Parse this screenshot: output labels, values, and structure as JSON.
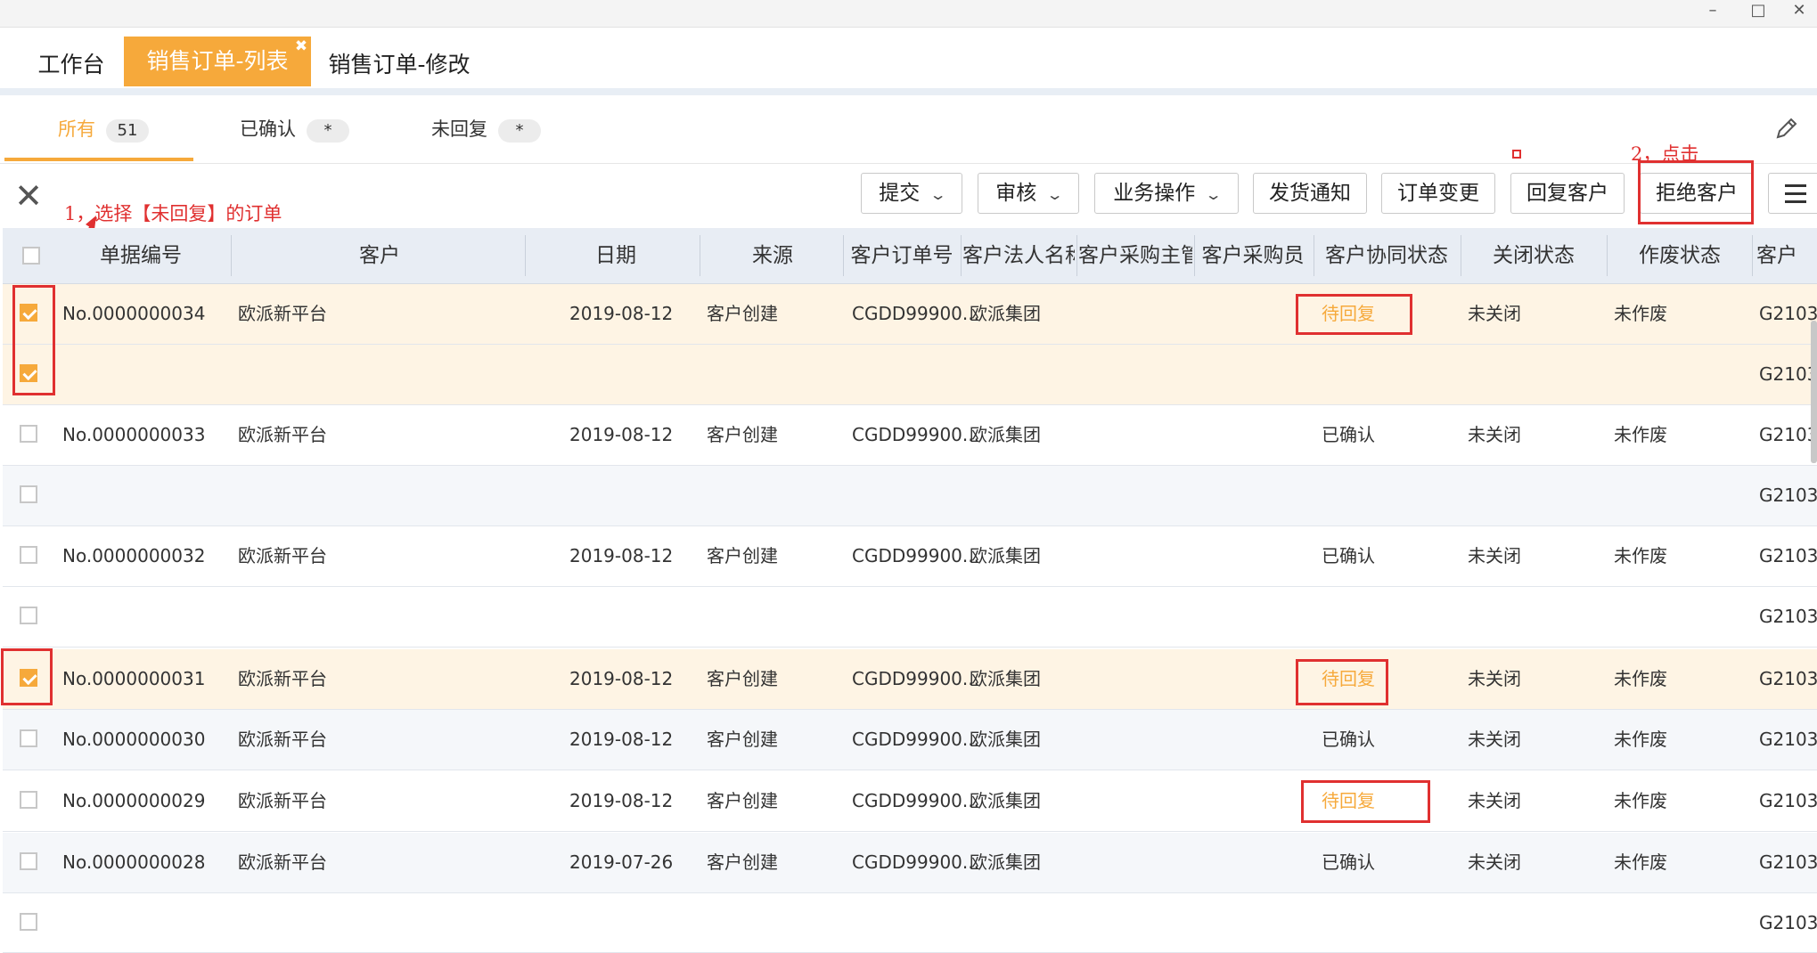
{
  "tabs": [
    {
      "label": "工作台"
    },
    {
      "label": "销售订单-列表",
      "active": true
    },
    {
      "label": "销售订单-修改"
    }
  ],
  "filters": [
    {
      "label": "所有",
      "count": "51"
    },
    {
      "label": "已确认",
      "count": "*"
    },
    {
      "label": "未回复",
      "count": "*"
    }
  ],
  "toolbar": {
    "submit": "提交",
    "review": "审核",
    "business_ops": "业务操作",
    "ship_notice": "发货通知",
    "order_change": "订单变更",
    "reply_customer": "回复客户",
    "reject_customer": "拒绝客户"
  },
  "annotations": {
    "step1": "1，选择【未回复】的订单",
    "step2": "2，点击"
  },
  "columns": [
    "单据编号",
    "客户",
    "日期",
    "来源",
    "客户订单号",
    "客户法人名称",
    "客户采购主管",
    "客户采购员",
    "客户协同状态",
    "关闭状态",
    "作废状态",
    "客户"
  ],
  "rows": [
    {
      "no": "No.0000000034",
      "customer": "欧派新平台",
      "date": "2019-08-12",
      "source": "客户创建",
      "order": "CGDD99900...",
      "legal": "欧派集团",
      "status": "待回复",
      "closed": "未关闭",
      "void": "未作废",
      "code": "G2103",
      "checked": true
    },
    {
      "no": "",
      "customer": "",
      "date": "",
      "source": "",
      "order": "",
      "legal": "",
      "status": "",
      "closed": "",
      "void": "",
      "code": "G2103",
      "checked": true
    },
    {
      "no": "No.0000000033",
      "customer": "欧派新平台",
      "date": "2019-08-12",
      "source": "客户创建",
      "order": "CGDD99900...",
      "legal": "欧派集团",
      "status": "已确认",
      "closed": "未关闭",
      "void": "未作废",
      "code": "G2103",
      "checked": false
    },
    {
      "no": "",
      "customer": "",
      "date": "",
      "source": "",
      "order": "",
      "legal": "",
      "status": "",
      "closed": "",
      "void": "",
      "code": "G2103",
      "checked": false
    },
    {
      "no": "No.0000000032",
      "customer": "欧派新平台",
      "date": "2019-08-12",
      "source": "客户创建",
      "order": "CGDD99900...",
      "legal": "欧派集团",
      "status": "已确认",
      "closed": "未关闭",
      "void": "未作废",
      "code": "G2103",
      "checked": false
    },
    {
      "no": "",
      "customer": "",
      "date": "",
      "source": "",
      "order": "",
      "legal": "",
      "status": "",
      "closed": "",
      "void": "",
      "code": "G2103",
      "checked": false
    },
    {
      "no": "No.0000000031",
      "customer": "欧派新平台",
      "date": "2019-08-12",
      "source": "客户创建",
      "order": "CGDD99900...",
      "legal": "欧派集团",
      "status": "待回复",
      "closed": "未关闭",
      "void": "未作废",
      "code": "G2103",
      "checked": true
    },
    {
      "no": "No.0000000030",
      "customer": "欧派新平台",
      "date": "2019-08-12",
      "source": "客户创建",
      "order": "CGDD99900...",
      "legal": "欧派集团",
      "status": "已确认",
      "closed": "未关闭",
      "void": "未作废",
      "code": "G2103",
      "checked": false
    },
    {
      "no": "No.0000000029",
      "customer": "欧派新平台",
      "date": "2019-08-12",
      "source": "客户创建",
      "order": "CGDD99900...",
      "legal": "欧派集团",
      "status": "待回复",
      "closed": "未关闭",
      "void": "未作废",
      "code": "G2103",
      "checked": false
    },
    {
      "no": "No.0000000028",
      "customer": "欧派新平台",
      "date": "2019-07-26",
      "source": "客户创建",
      "order": "CGDD99900...",
      "legal": "欧派集团",
      "status": "已确认",
      "closed": "未关闭",
      "void": "未作废",
      "code": "G2103",
      "checked": false
    },
    {
      "no": "",
      "customer": "",
      "date": "",
      "source": "",
      "order": "",
      "legal": "",
      "status": "",
      "closed": "",
      "void": "",
      "code": "G2103",
      "checked": false
    }
  ],
  "colors": {
    "accent": "#f6a93b",
    "annotation": "#e03030",
    "header_bg": "#e8edf4"
  }
}
